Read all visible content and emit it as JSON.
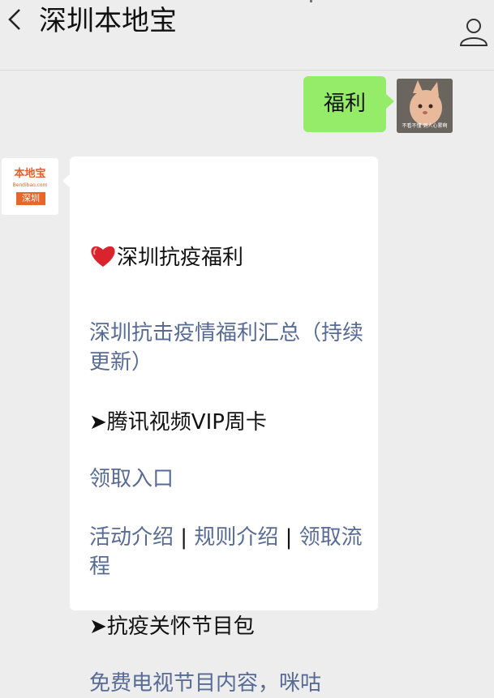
{
  "header": {
    "title": "深圳本地宝"
  },
  "messages": {
    "outgoing_text": "福利",
    "user_avatar_caption": "不看不懂 到人心累啊"
  },
  "bot": {
    "logo_brand": "本地宝",
    "logo_domain": "Bendibao.com",
    "logo_city": "深圳"
  },
  "card": {
    "section1_title": "深圳抗疫福利",
    "link1": "深圳抗击疫情福利汇总（持续更新）",
    "section2_title": "➤腾讯视频VIP周卡",
    "link2": "领取入口",
    "link3a": "活动介绍",
    "sep": " | ",
    "link3b": "规则介绍",
    "link3c": "领取流程",
    "section3_title": "➤抗疫关怀节目包",
    "link4_partial": "免费电视节目内容，咪咕"
  },
  "colors": {
    "outgoing_bubble": "#95ec69",
    "link": "#576b95",
    "background": "#ededed"
  }
}
